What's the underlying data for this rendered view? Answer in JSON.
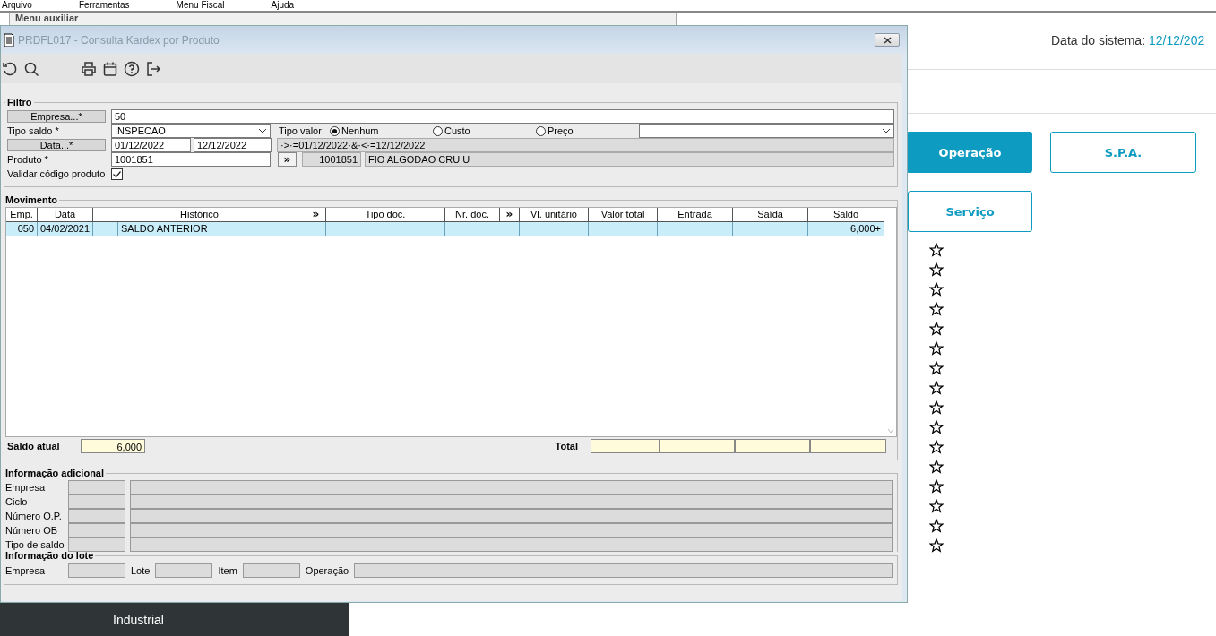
{
  "background_app": {
    "menu_bar": [
      "Arquivo",
      "Ferramentas",
      "Menu Fiscal",
      "Ajuda"
    ],
    "auxiliary_panel": {
      "title": "Menu auxiliar"
    },
    "system_date": {
      "label": "Data do sistema:",
      "value": "12/12/202"
    },
    "buttons": [
      {
        "label": "Operação",
        "selected": true
      },
      {
        "label": "S.P.A.",
        "selected": false
      },
      {
        "label": "Serviço",
        "selected": false
      }
    ],
    "favorites": [
      {
        "starred": false
      },
      {
        "starred": false
      },
      {
        "starred": false
      },
      {
        "starred": false
      },
      {
        "starred": false
      },
      {
        "starred": false
      },
      {
        "starred": false
      },
      {
        "starred": false
      },
      {
        "starred": false
      },
      {
        "starred": false
      },
      {
        "starred": false
      },
      {
        "starred": false
      },
      {
        "starred": false
      },
      {
        "starred": false
      },
      {
        "starred": false
      },
      {
        "starred": false
      }
    ],
    "bottom_bar": {
      "label": "Industrial"
    }
  },
  "window": {
    "title": "PRDFL017 - Consulta Kardex por Produto",
    "filter": {
      "title": "Filtro",
      "empresa": {
        "label": "Empresa...*",
        "value": "50"
      },
      "tipo_saldo": {
        "label": "Tipo saldo *",
        "value": "INSPECAO"
      },
      "tipo_valor": {
        "label": "Tipo valor:",
        "options": [
          {
            "label": "Nenhum",
            "selected": true
          },
          {
            "label": "Custo",
            "selected": false
          },
          {
            "label": "Preço",
            "selected": false
          }
        ]
      },
      "data": {
        "label": "Data...*",
        "from": "01/12/2022",
        "to": "12/12/2022",
        "expression": "·>·=01/12/2022·&·<·=12/12/2022"
      },
      "produto": {
        "label": "Produto *",
        "value": "1001851",
        "lookup_button": "»",
        "code": "1001851",
        "description": "FIO ALGODAO CRU U"
      },
      "validar": {
        "label": "Validar código produto",
        "checked": true
      }
    },
    "movement": {
      "title": "Movimento",
      "columns": [
        "Emp.",
        "Data",
        "Histórico",
        "»",
        "Tipo doc.",
        "Nr. doc.",
        "»",
        "Vl. unitário",
        "Valor total",
        "Entrada",
        "Saída",
        "Saldo"
      ],
      "rows": [
        {
          "selected": true,
          "emp": "050",
          "data": "04/02/2021",
          "historico": "SALDO ANTERIOR",
          "saldo": "6,000+"
        }
      ],
      "saldo_atual": {
        "label": "Saldo atual",
        "value": "6,000"
      },
      "total": {
        "label": "Total"
      }
    },
    "additional_info": {
      "title": "Informação adicional",
      "fields": [
        "Empresa",
        "Ciclo",
        "Número O.P.",
        "Número OB",
        "Tipo de saldo"
      ]
    },
    "lot_info": {
      "title": "Informação do lote",
      "fields": [
        "Empresa",
        "Lote",
        "Item",
        "Operação"
      ]
    }
  }
}
